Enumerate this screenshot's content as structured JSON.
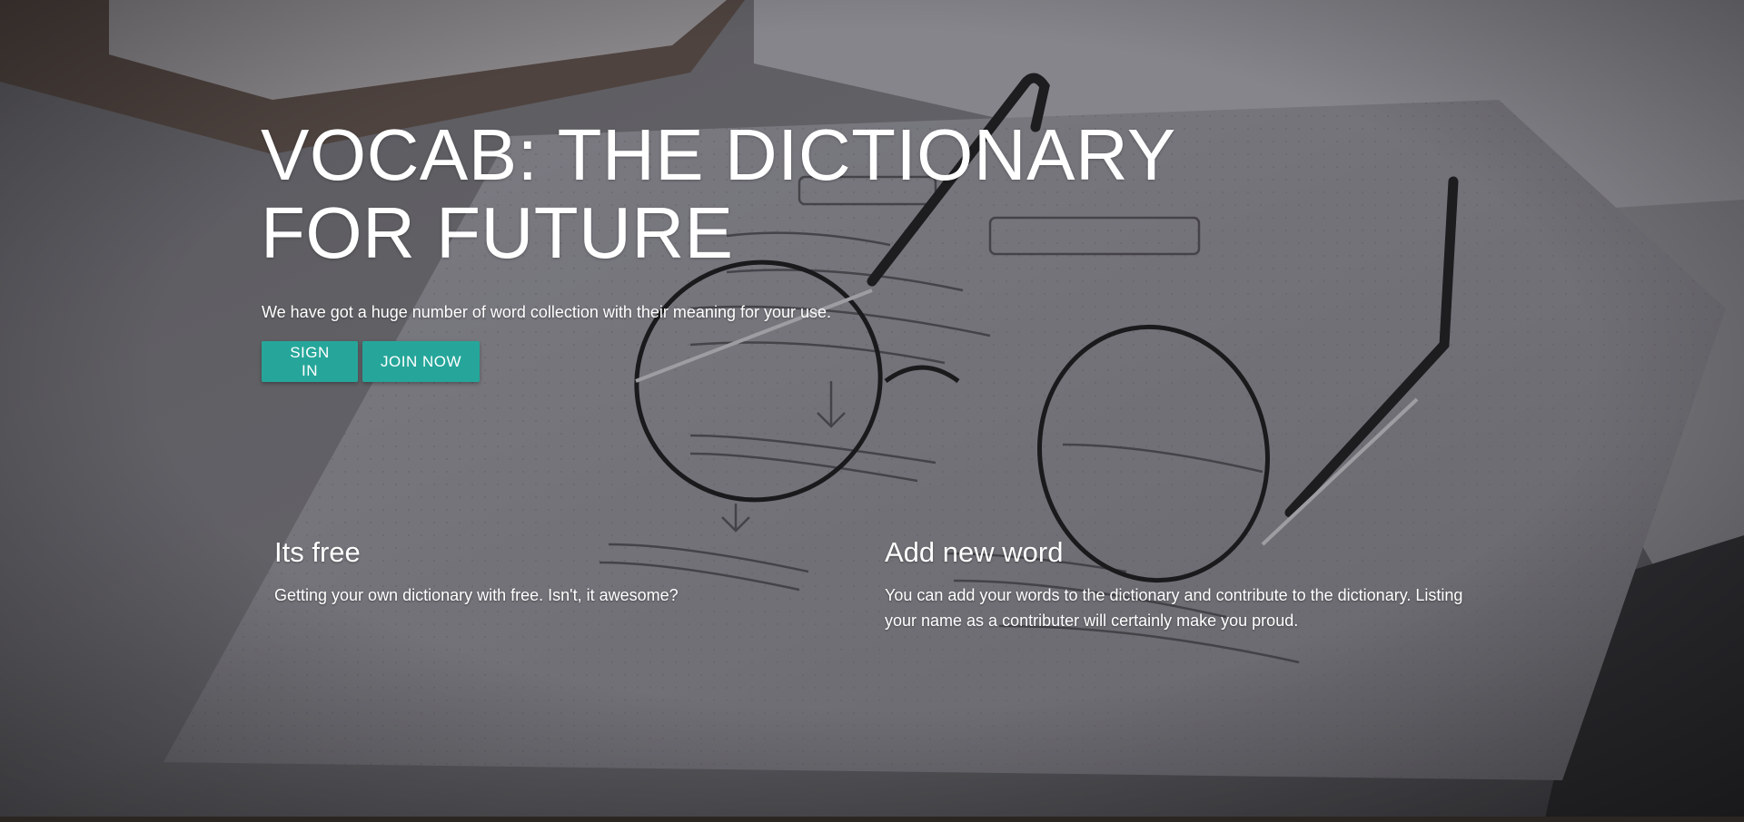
{
  "hero": {
    "title": "VOCAB: THE DICTIONARY FOR FUTURE",
    "subtitle": "We have got a huge number of word collection with their meaning for your use.",
    "background": "glasses-on-notebook-photo"
  },
  "actions": {
    "sign_in_label": "SIGN IN",
    "join_now_label": "JOIN NOW"
  },
  "features": [
    {
      "title": "Its free",
      "text": "Getting your own dictionary with free. Isn't, it awesome?"
    },
    {
      "title": "Add new word",
      "text": "You can add your words to the dictionary and contribute to the dictionary. Listing your name as a contributer will certainly make you proud."
    }
  ],
  "colors": {
    "accent": "#26a69a",
    "overlay": "#5a5a60",
    "text": "#ffffff"
  }
}
